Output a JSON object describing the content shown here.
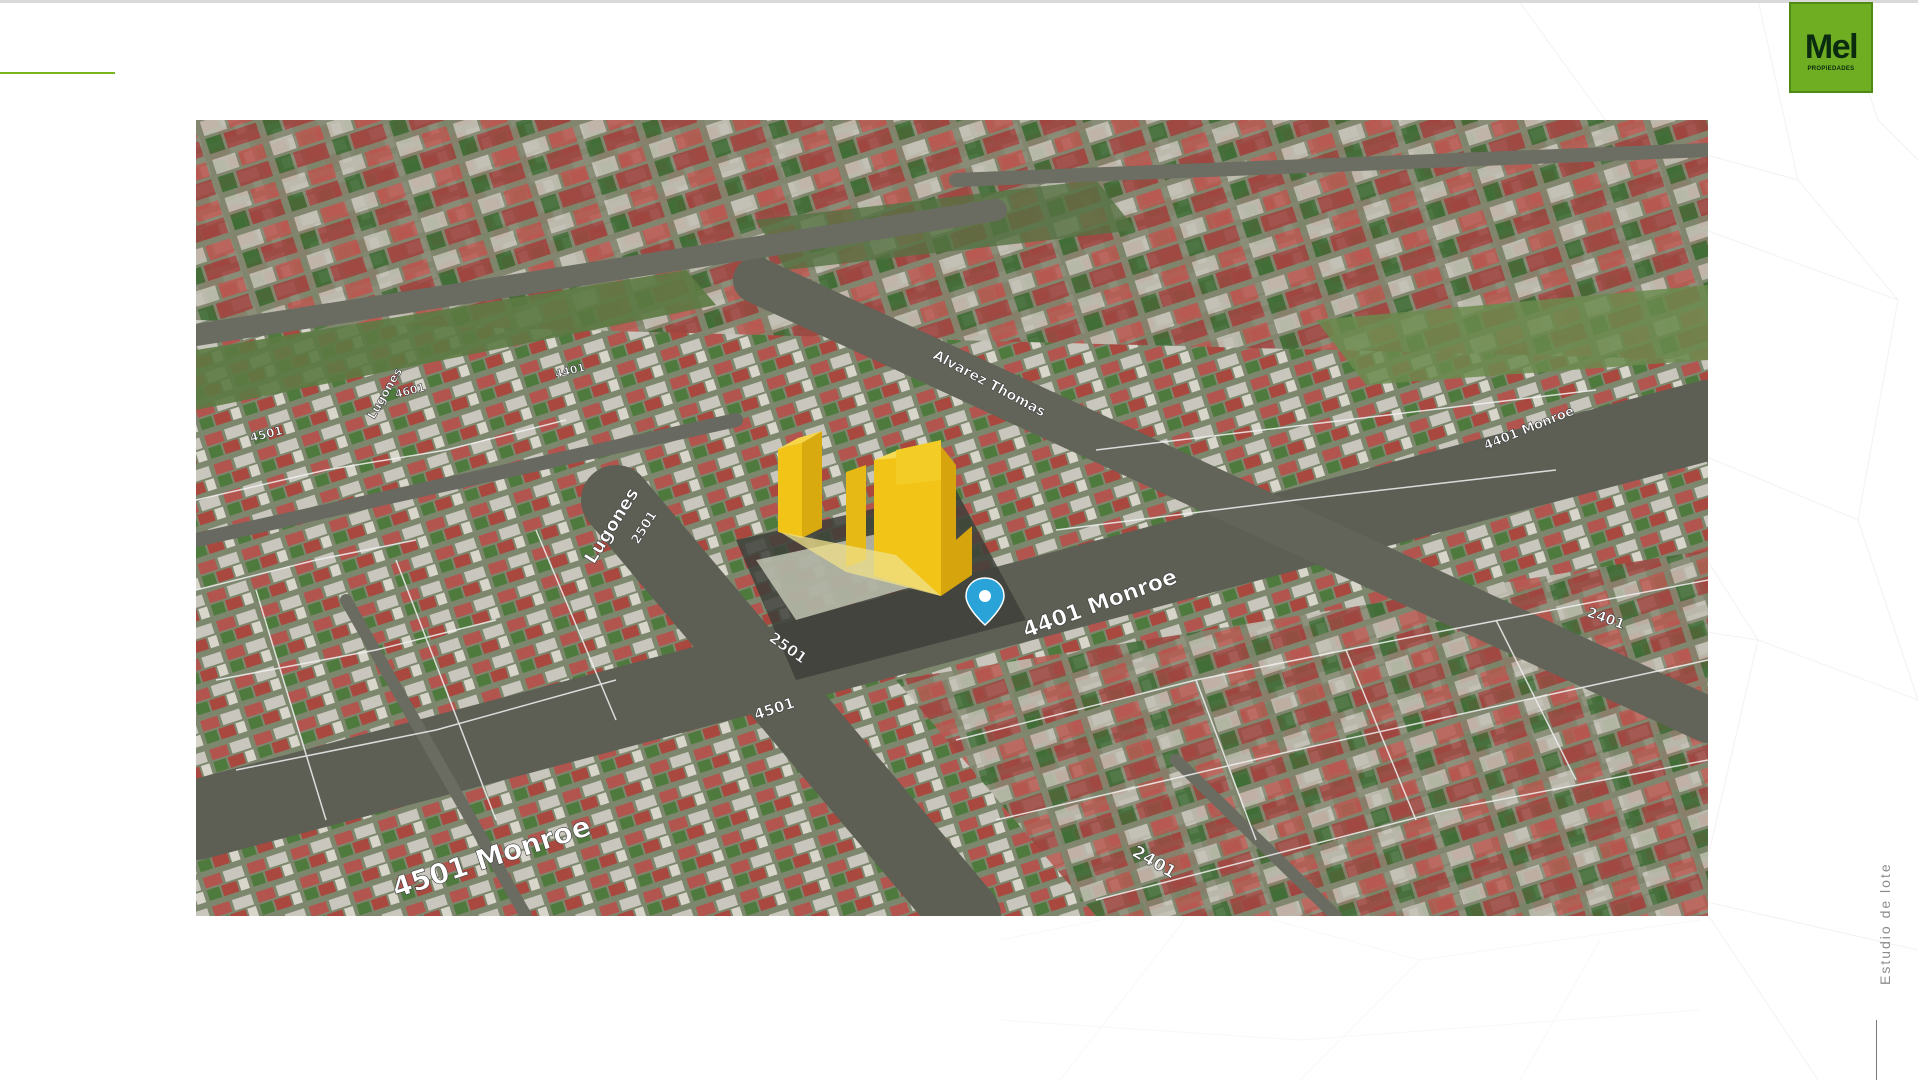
{
  "slide": {
    "vertical_label": "Estudio de lote",
    "accent_color": "#7ab51d"
  },
  "logo": {
    "word": "Mel",
    "sub": "PROPIEDADES",
    "color": "#6fae22"
  },
  "map": {
    "type": "3d-satellite-aerial",
    "marker_icon": "location-pin-icon",
    "marker_color": "#2aa3d9",
    "building_color": "#f2c418",
    "street_labels": {
      "monroe_main": "4401 Monroe",
      "monroe_front": "4501 Monroe",
      "lugones": "Lugones",
      "lugones_number": "2501",
      "corner_2501": "2501",
      "corner_4501": "4501",
      "alvarez_thomas": "Alvarez Thomas",
      "monroe_far": "4401 Monroe",
      "block_2401_right": "2401",
      "block_2401_bottom": "2401",
      "left_4501": "4501",
      "left_lugones": "Lugones",
      "top_4401": "4401",
      "top_4601": "4601"
    }
  }
}
